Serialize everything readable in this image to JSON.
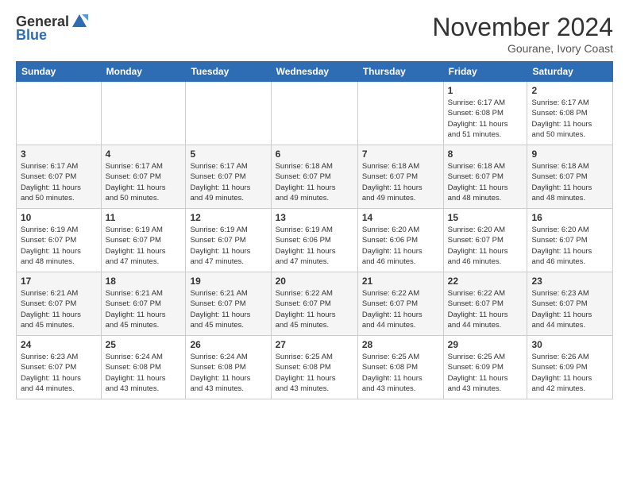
{
  "logo": {
    "general": "General",
    "blue": "Blue"
  },
  "header": {
    "title": "November 2024",
    "subtitle": "Gourane, Ivory Coast"
  },
  "weekdays": [
    "Sunday",
    "Monday",
    "Tuesday",
    "Wednesday",
    "Thursday",
    "Friday",
    "Saturday"
  ],
  "weeks": [
    [
      {
        "day": "",
        "info": ""
      },
      {
        "day": "",
        "info": ""
      },
      {
        "day": "",
        "info": ""
      },
      {
        "day": "",
        "info": ""
      },
      {
        "day": "",
        "info": ""
      },
      {
        "day": "1",
        "info": "Sunrise: 6:17 AM\nSunset: 6:08 PM\nDaylight: 11 hours\nand 51 minutes."
      },
      {
        "day": "2",
        "info": "Sunrise: 6:17 AM\nSunset: 6:08 PM\nDaylight: 11 hours\nand 50 minutes."
      }
    ],
    [
      {
        "day": "3",
        "info": "Sunrise: 6:17 AM\nSunset: 6:07 PM\nDaylight: 11 hours\nand 50 minutes."
      },
      {
        "day": "4",
        "info": "Sunrise: 6:17 AM\nSunset: 6:07 PM\nDaylight: 11 hours\nand 50 minutes."
      },
      {
        "day": "5",
        "info": "Sunrise: 6:17 AM\nSunset: 6:07 PM\nDaylight: 11 hours\nand 49 minutes."
      },
      {
        "day": "6",
        "info": "Sunrise: 6:18 AM\nSunset: 6:07 PM\nDaylight: 11 hours\nand 49 minutes."
      },
      {
        "day": "7",
        "info": "Sunrise: 6:18 AM\nSunset: 6:07 PM\nDaylight: 11 hours\nand 49 minutes."
      },
      {
        "day": "8",
        "info": "Sunrise: 6:18 AM\nSunset: 6:07 PM\nDaylight: 11 hours\nand 48 minutes."
      },
      {
        "day": "9",
        "info": "Sunrise: 6:18 AM\nSunset: 6:07 PM\nDaylight: 11 hours\nand 48 minutes."
      }
    ],
    [
      {
        "day": "10",
        "info": "Sunrise: 6:19 AM\nSunset: 6:07 PM\nDaylight: 11 hours\nand 48 minutes."
      },
      {
        "day": "11",
        "info": "Sunrise: 6:19 AM\nSunset: 6:07 PM\nDaylight: 11 hours\nand 47 minutes."
      },
      {
        "day": "12",
        "info": "Sunrise: 6:19 AM\nSunset: 6:07 PM\nDaylight: 11 hours\nand 47 minutes."
      },
      {
        "day": "13",
        "info": "Sunrise: 6:19 AM\nSunset: 6:06 PM\nDaylight: 11 hours\nand 47 minutes."
      },
      {
        "day": "14",
        "info": "Sunrise: 6:20 AM\nSunset: 6:06 PM\nDaylight: 11 hours\nand 46 minutes."
      },
      {
        "day": "15",
        "info": "Sunrise: 6:20 AM\nSunset: 6:07 PM\nDaylight: 11 hours\nand 46 minutes."
      },
      {
        "day": "16",
        "info": "Sunrise: 6:20 AM\nSunset: 6:07 PM\nDaylight: 11 hours\nand 46 minutes."
      }
    ],
    [
      {
        "day": "17",
        "info": "Sunrise: 6:21 AM\nSunset: 6:07 PM\nDaylight: 11 hours\nand 45 minutes."
      },
      {
        "day": "18",
        "info": "Sunrise: 6:21 AM\nSunset: 6:07 PM\nDaylight: 11 hours\nand 45 minutes."
      },
      {
        "day": "19",
        "info": "Sunrise: 6:21 AM\nSunset: 6:07 PM\nDaylight: 11 hours\nand 45 minutes."
      },
      {
        "day": "20",
        "info": "Sunrise: 6:22 AM\nSunset: 6:07 PM\nDaylight: 11 hours\nand 45 minutes."
      },
      {
        "day": "21",
        "info": "Sunrise: 6:22 AM\nSunset: 6:07 PM\nDaylight: 11 hours\nand 44 minutes."
      },
      {
        "day": "22",
        "info": "Sunrise: 6:22 AM\nSunset: 6:07 PM\nDaylight: 11 hours\nand 44 minutes."
      },
      {
        "day": "23",
        "info": "Sunrise: 6:23 AM\nSunset: 6:07 PM\nDaylight: 11 hours\nand 44 minutes."
      }
    ],
    [
      {
        "day": "24",
        "info": "Sunrise: 6:23 AM\nSunset: 6:07 PM\nDaylight: 11 hours\nand 44 minutes."
      },
      {
        "day": "25",
        "info": "Sunrise: 6:24 AM\nSunset: 6:08 PM\nDaylight: 11 hours\nand 43 minutes."
      },
      {
        "day": "26",
        "info": "Sunrise: 6:24 AM\nSunset: 6:08 PM\nDaylight: 11 hours\nand 43 minutes."
      },
      {
        "day": "27",
        "info": "Sunrise: 6:25 AM\nSunset: 6:08 PM\nDaylight: 11 hours\nand 43 minutes."
      },
      {
        "day": "28",
        "info": "Sunrise: 6:25 AM\nSunset: 6:08 PM\nDaylight: 11 hours\nand 43 minutes."
      },
      {
        "day": "29",
        "info": "Sunrise: 6:25 AM\nSunset: 6:09 PM\nDaylight: 11 hours\nand 43 minutes."
      },
      {
        "day": "30",
        "info": "Sunrise: 6:26 AM\nSunset: 6:09 PM\nDaylight: 11 hours\nand 42 minutes."
      }
    ]
  ]
}
